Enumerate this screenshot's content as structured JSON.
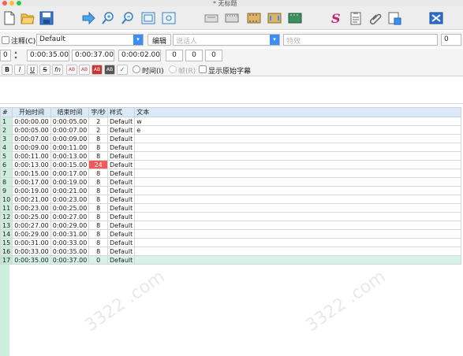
{
  "window": {
    "title": "* 无标题"
  },
  "toolbar": {
    "icons": [
      "new-file-icon",
      "open-folder-icon",
      "save-icon",
      "arrow-right-icon",
      "zoom-in-icon",
      "zoom-out-icon",
      "frame-icon",
      "frame-alt-icon",
      "timing-icon",
      "film-icon",
      "film-alt-icon",
      "style-s-icon",
      "properties-icon",
      "attach-icon",
      "export-icon"
    ]
  },
  "row2": {
    "comment_label": "注释(C)",
    "style_value": "Default",
    "edit_button": "编辑",
    "actor_placeholder": "说话人",
    "effect_placeholder": "特效",
    "layer_value": "0"
  },
  "row3": {
    "layer_value": "0",
    "start_time": "0:00:35.00",
    "end_time": "0:00:37.00",
    "duration": "0:00:02.00",
    "margin_l": "0",
    "margin_r": "0",
    "margin_v": "0"
  },
  "row4": {
    "bold": "B",
    "italic": "I",
    "underline": "U",
    "strike": "S",
    "fn": "fn",
    "ab1": "AB",
    "ab2": "AB",
    "ab3": "AB",
    "ab4": "AB",
    "commit": "✓",
    "time_radio": "时间(I)",
    "frame_radio": "帧(R)",
    "show_original": "显示原始字幕"
  },
  "grid": {
    "headers": [
      "#",
      "开始时间",
      "结束时间",
      "字/秒",
      "样式",
      "文本"
    ],
    "rows": [
      {
        "n": "1",
        "start": "0:00:00.00",
        "end": "0:00:05.00",
        "cps": "2",
        "style": "Default",
        "text": "w"
      },
      {
        "n": "2",
        "start": "0:00:05.00",
        "end": "0:00:07.00",
        "cps": "2",
        "style": "Default",
        "text": "e"
      },
      {
        "n": "3",
        "start": "0:00:07.00",
        "end": "0:00:09.00",
        "cps": "8",
        "style": "Default",
        "text": ""
      },
      {
        "n": "4",
        "start": "0:00:09.00",
        "end": "0:00:11.00",
        "cps": "8",
        "style": "Default",
        "text": ""
      },
      {
        "n": "5",
        "start": "0:00:11.00",
        "end": "0:00:13.00",
        "cps": "8",
        "style": "Default",
        "text": ""
      },
      {
        "n": "6",
        "start": "0:00:13.00",
        "end": "0:00:15.00",
        "cps": "24",
        "style": "Default",
        "text": ""
      },
      {
        "n": "7",
        "start": "0:00:15.00",
        "end": "0:00:17.00",
        "cps": "8",
        "style": "Default",
        "text": ""
      },
      {
        "n": "8",
        "start": "0:00:17.00",
        "end": "0:00:19.00",
        "cps": "8",
        "style": "Default",
        "text": ""
      },
      {
        "n": "9",
        "start": "0:00:19.00",
        "end": "0:00:21.00",
        "cps": "8",
        "style": "Default",
        "text": ""
      },
      {
        "n": "10",
        "start": "0:00:21.00",
        "end": "0:00:23.00",
        "cps": "8",
        "style": "Default",
        "text": ""
      },
      {
        "n": "11",
        "start": "0:00:23.00",
        "end": "0:00:25.00",
        "cps": "8",
        "style": "Default",
        "text": ""
      },
      {
        "n": "12",
        "start": "0:00:25.00",
        "end": "0:00:27.00",
        "cps": "8",
        "style": "Default",
        "text": ""
      },
      {
        "n": "13",
        "start": "0:00:27.00",
        "end": "0:00:29.00",
        "cps": "8",
        "style": "Default",
        "text": ""
      },
      {
        "n": "14",
        "start": "0:00:29.00",
        "end": "0:00:31.00",
        "cps": "8",
        "style": "Default",
        "text": ""
      },
      {
        "n": "15",
        "start": "0:00:31.00",
        "end": "0:00:33.00",
        "cps": "8",
        "style": "Default",
        "text": ""
      },
      {
        "n": "16",
        "start": "0:00:33.00",
        "end": "0:00:35.00",
        "cps": "8",
        "style": "Default",
        "text": ""
      },
      {
        "n": "17",
        "start": "0:00:35.00",
        "end": "0:00:37.00",
        "cps": "0",
        "style": "Default",
        "text": ""
      }
    ],
    "hot_row": "6",
    "selected_row": "17",
    "colors": {
      "hot": "#f05a5a",
      "selected": "#d6f2ea",
      "header": "#dbe8f5"
    }
  }
}
